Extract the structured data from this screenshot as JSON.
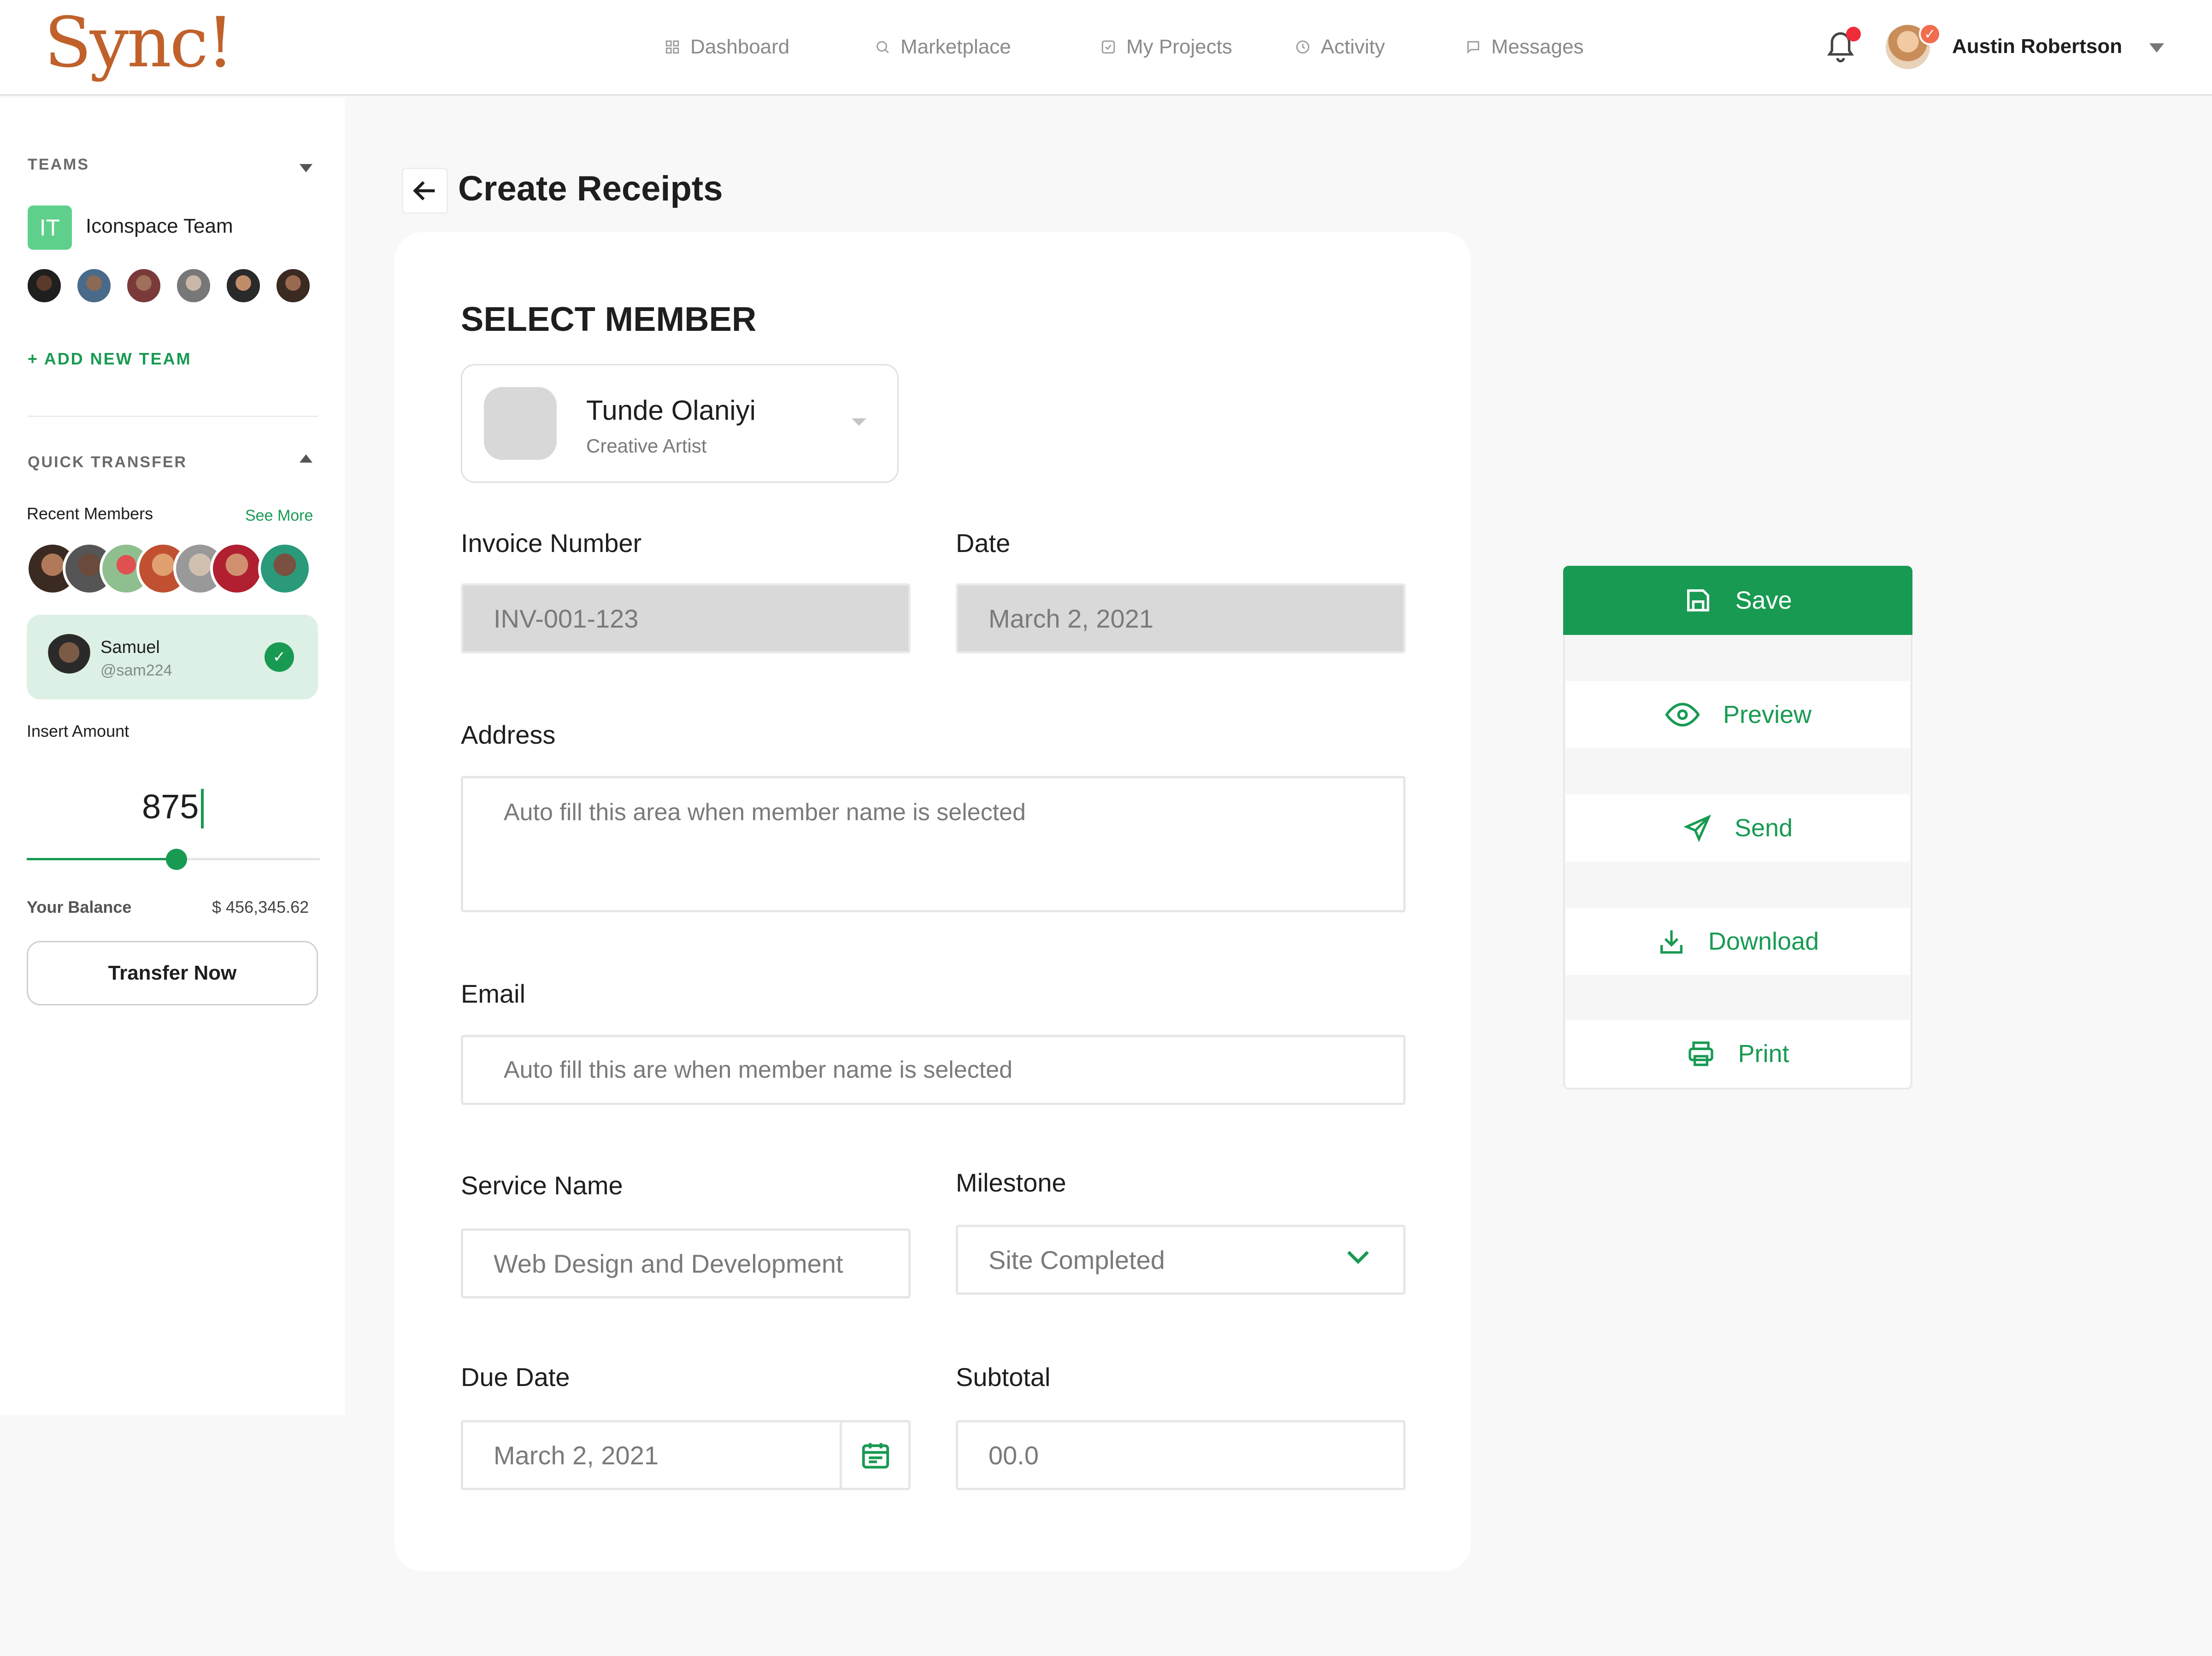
{
  "header": {
    "logo": "Sync!",
    "nav": [
      {
        "label": "Dashboard",
        "icon": "grid-icon"
      },
      {
        "label": "Marketplace",
        "icon": "search-icon"
      },
      {
        "label": "My Projects",
        "icon": "check-square-icon"
      },
      {
        "label": "Activity",
        "icon": "clock-icon"
      },
      {
        "label": "Messages",
        "icon": "message-icon"
      }
    ],
    "user_name": "Austin Robertson"
  },
  "sidebar": {
    "teams_label": "TEAMS",
    "team_badge": "IT",
    "team_name": "Iconspace Team",
    "add_team": "+ ADD NEW TEAM",
    "quick_transfer_label": "QUICK TRANSFER",
    "recent_members_label": "Recent Members",
    "see_more": "See More",
    "selected_member": {
      "name": "Samuel",
      "handle": "@sam224"
    },
    "insert_amount_label": "Insert Amount",
    "amount": "875",
    "amount_slider_fraction": 0.51,
    "balance_label": "Your Balance",
    "balance_value": "$ 456,345.62",
    "transfer_button": "Transfer Now"
  },
  "main": {
    "page_title": "Create Receipts",
    "select_member_title": "SELECT MEMBER",
    "member": {
      "name": "Tunde Olaniyi",
      "role": "Creative Artist"
    },
    "invoice_number_label": "Invoice Number",
    "invoice_number_value": "INV-001-123",
    "date_label": "Date",
    "date_value": "March 2, 2021",
    "address_label": "Address",
    "address_placeholder": "Auto fill this area when member name is selected",
    "email_label": "Email",
    "email_placeholder": "Auto fill this are when member name is selected",
    "service_name_label": "Service Name",
    "service_name_value": "Web Design and Development",
    "milestone_label": "Milestone",
    "milestone_value": "Site Completed",
    "due_date_label": "Due Date",
    "due_date_value": "March 2, 2021",
    "subtotal_label": "Subtotal",
    "subtotal_value": "00.0"
  },
  "actions": {
    "save": "Save",
    "preview": "Preview",
    "send": "Send",
    "download": "Download",
    "print": "Print"
  },
  "colors": {
    "accent": "#189a52",
    "notification": "#ef2d3a",
    "logo": "#c0612b"
  }
}
